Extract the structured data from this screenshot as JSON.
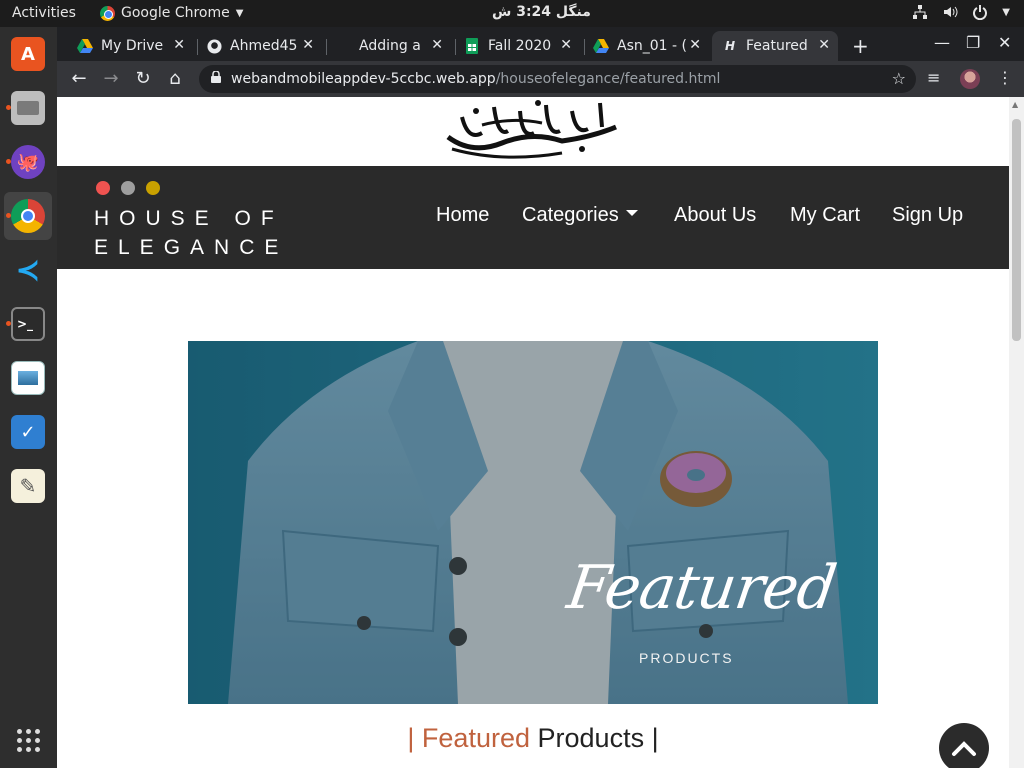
{
  "topbar": {
    "activities": "Activities",
    "app_name": "Google Chrome",
    "clock": "منگل  3:24 ش"
  },
  "dock": {
    "items": [
      "software-center",
      "files",
      "github-desktop",
      "google-chrome",
      "vscode",
      "terminal",
      "image-viewer",
      "tasks",
      "text-editor",
      "show-applications"
    ]
  },
  "browser": {
    "tabs": [
      {
        "title": "My Drive",
        "icon": "google-drive-icon"
      },
      {
        "title": "Ahmed45",
        "icon": "github-icon"
      },
      {
        "title": "Adding a",
        "icon": "blank-icon"
      },
      {
        "title": "Fall 2020",
        "icon": "google-sheets-icon"
      },
      {
        "title": "Asn_01 - (",
        "icon": "google-drive-icon"
      },
      {
        "title": "Featured",
        "icon": "page-icon",
        "active": true
      }
    ],
    "url_host": "webandmobileappdev-5ccbc.web.app",
    "url_path": "/houseofelegance/featured.html"
  },
  "site": {
    "brand_line1": "HOUSE OF",
    "brand_line2": "ELEGANCE",
    "nav": {
      "home": "Home",
      "categories": "Categories",
      "about": "About Us",
      "cart": "My Cart",
      "signup": "Sign Up"
    },
    "hero": {
      "title": "Featured",
      "subtitle": "PRODUCTS"
    },
    "section": {
      "bar_left": "|",
      "accent": "Featured",
      "rest": "Products",
      "bar_right": "|"
    }
  },
  "colors": {
    "accent": "#c0623e",
    "nav_bg": "#2a2a2a",
    "dot_red": "#ef5350",
    "dot_grey": "#9e9e9e",
    "dot_gold": "#c9a100"
  }
}
